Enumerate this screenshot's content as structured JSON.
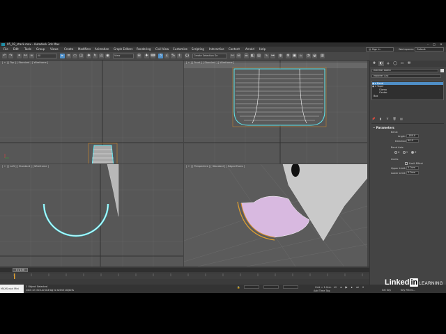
{
  "window": {
    "title": "05_02_stack.max - Autodesk 3ds Max",
    "controls": {
      "minimize": "–",
      "maximize": "□",
      "close": "✕"
    }
  },
  "menu": [
    "File",
    "Edit",
    "Tools",
    "Group",
    "Views",
    "Create",
    "Modifiers",
    "Animation",
    "Graph Editors",
    "Rendering",
    "Civil View",
    "Customize",
    "Scripting",
    "Interactive",
    "Content",
    "Arnold",
    "Help"
  ],
  "account": {
    "signin": "Sign In",
    "workspaces_label": "Workspaces:",
    "workspace_value": "Default"
  },
  "toolbar": {
    "filter_value": "All",
    "view_value": "View",
    "selection_set": "Create Selection Se"
  },
  "viewports": {
    "top": "[ + ] [ Top ] [ Standard ] [ Wireframe ]",
    "front": "[ + ] [ Front ] [ Standard ] [ Wireframe ]",
    "left": "[ + ] [ Left ] [ Standard ] [ Wireframe ]",
    "perspective": "[ + ] [ Perspective ] [ Standard ] [ Edged Faces ]"
  },
  "command_panel": {
    "object_name": "exterior stand",
    "modifier_list": "Modifier List",
    "stack": [
      "Bend",
      "Taper",
      "Gizmo",
      "Center",
      "Box"
    ],
    "params_title": "Parameters",
    "bend_label": "Bend:",
    "angle_label": "Angle:",
    "angle_value": "-180.0",
    "direction_label": "Direction:",
    "direction_value": "90.0",
    "bend_axis_label": "Bend Axis:",
    "axis_x": "X",
    "axis_y": "Y",
    "axis_z": "Z",
    "limits_label": "Limits",
    "limit_effect": "Limit Effect",
    "upper_label": "Upper Limit:",
    "upper_value": "0.0cm",
    "lower_label": "Lower Limit:",
    "lower_value": "0.0cm"
  },
  "timeline": {
    "frame": "0 / 100"
  },
  "status": {
    "maxscript": "MAXScript Mini",
    "selected": "1 Object Selected",
    "prompt": "Click or click-and-drag to select objects",
    "grid": "Grid = 1.0cm",
    "add_time_tag": "Add Time Tag",
    "set_key": "Set Key",
    "key_filters": "Key Filters...",
    "auto": "Auto",
    "selected_dd": "Selected",
    "frame_value": "0"
  },
  "watermark": {
    "linked": "Linked",
    "in": "in",
    "learning": "LEARNING"
  },
  "colors": {
    "accent": "#4f8fc8",
    "selection_cyan": "#5fe8f0",
    "bg": "#444444"
  }
}
